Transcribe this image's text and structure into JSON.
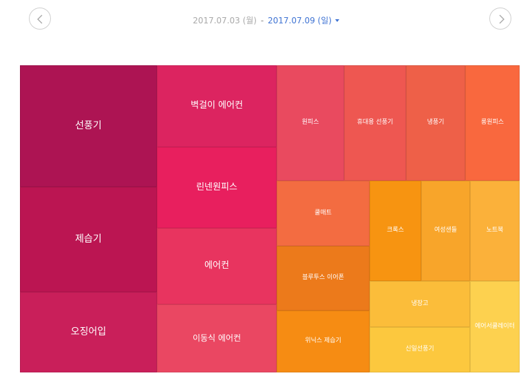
{
  "date_range": {
    "start": "2017.07.03 (월)",
    "separator": "-",
    "end": "2017.07.09 (일)"
  },
  "nav": {
    "prev_icon": "chevron-left-icon",
    "next_icon": "chevron-right-icon"
  },
  "chart_data": {
    "type": "treemap",
    "title": "",
    "layout_order": "columns left to right, largest items first",
    "items": [
      {
        "label": "선풍기",
        "value": 100,
        "color": "#ad1453"
      },
      {
        "label": "제습기",
        "value": 84,
        "color": "#bb1552"
      },
      {
        "label": "오징어입",
        "value": 64,
        "color": "#c91f5a"
      },
      {
        "label": "벽걸이 에어컨",
        "value": 51,
        "color": "#dc2460"
      },
      {
        "label": "린넨원피스",
        "value": 51,
        "color": "#e81f5e"
      },
      {
        "label": "에어컨",
        "value": 48,
        "color": "#e8345f"
      },
      {
        "label": "이동식 에어컨",
        "value": 43,
        "color": "#ea4762"
      },
      {
        "label": "원피스",
        "value": 28,
        "color": "#e94a5f"
      },
      {
        "label": "휴대용 선풍기",
        "value": 25,
        "color": "#ee5751"
      },
      {
        "label": "냉풍기",
        "value": 25,
        "color": "#ee6048"
      },
      {
        "label": "롱원피스",
        "value": 22,
        "color": "#f9683e"
      },
      {
        "label": "쿨매트",
        "value": 24,
        "color": "#f36c41"
      },
      {
        "label": "블루투스 이어폰",
        "value": 23,
        "color": "#ec7a1b"
      },
      {
        "label": "위닉스 제습기",
        "value": 22,
        "color": "#f68c13"
      },
      {
        "label": "크록스",
        "value": 20,
        "color": "#f79411"
      },
      {
        "label": "여성샌들",
        "value": 19,
        "color": "#f8a52a"
      },
      {
        "label": "노트북",
        "value": 18,
        "color": "#fbb13a"
      },
      {
        "label": "냉장고",
        "value": 15,
        "color": "#fbbd3a"
      },
      {
        "label": "신일선풍기",
        "value": 14,
        "color": "#fcc83e"
      },
      {
        "label": "에어서쿨레이터",
        "value": 14,
        "color": "#fdd14f"
      }
    ]
  }
}
